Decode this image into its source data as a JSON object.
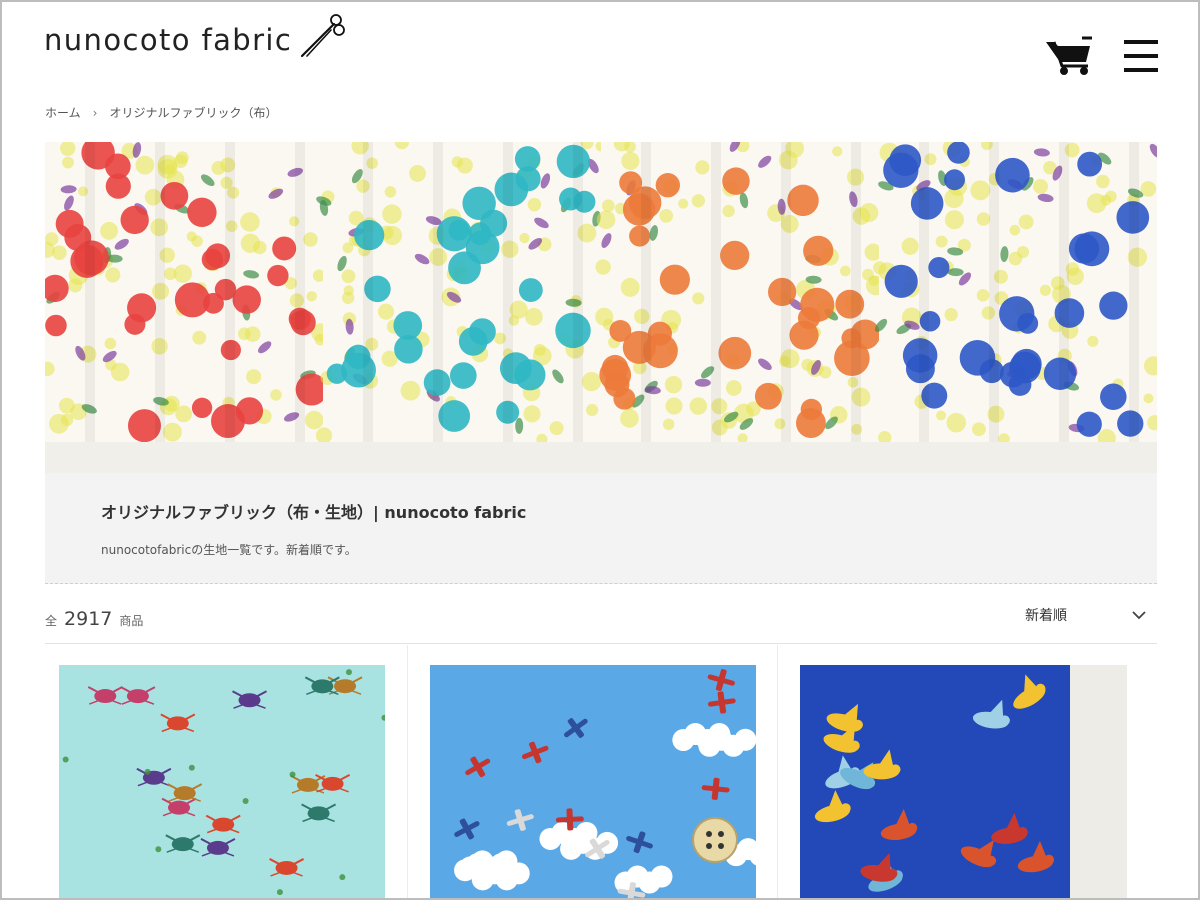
{
  "header": {
    "logo_text": "nunocoto fabric",
    "logo_icon": "scissors-icon",
    "cart_icon": "cart-icon",
    "menu_icon": "hamburger-menu-icon"
  },
  "breadcrumb": {
    "home": "ホーム",
    "separator": "›",
    "current": "オリジナルファブリック（布）"
  },
  "hero": {
    "fabric_colors": [
      "#e8423f",
      "#2fb7c4",
      "#ec7a3a",
      "#2d58c7"
    ],
    "accent_colors": [
      "#e6e34c",
      "#7d3fa0",
      "#3f8f4a"
    ]
  },
  "category": {
    "title": "オリジナルファブリック（布・生地）| nunocoto fabric",
    "description": "nunocotofabricの生地一覧です。新着順です。"
  },
  "listing": {
    "count_prefix": "全",
    "count": "2917",
    "count_suffix": "商品",
    "sort_label": "新着順",
    "sort_icon": "chevron-down-icon"
  },
  "products": [
    {
      "pattern": "crabs",
      "background": "#a9e3e1"
    },
    {
      "pattern": "airplanes",
      "background": "#5aa8e6"
    },
    {
      "pattern": "birds",
      "background": "#2348b8"
    }
  ]
}
